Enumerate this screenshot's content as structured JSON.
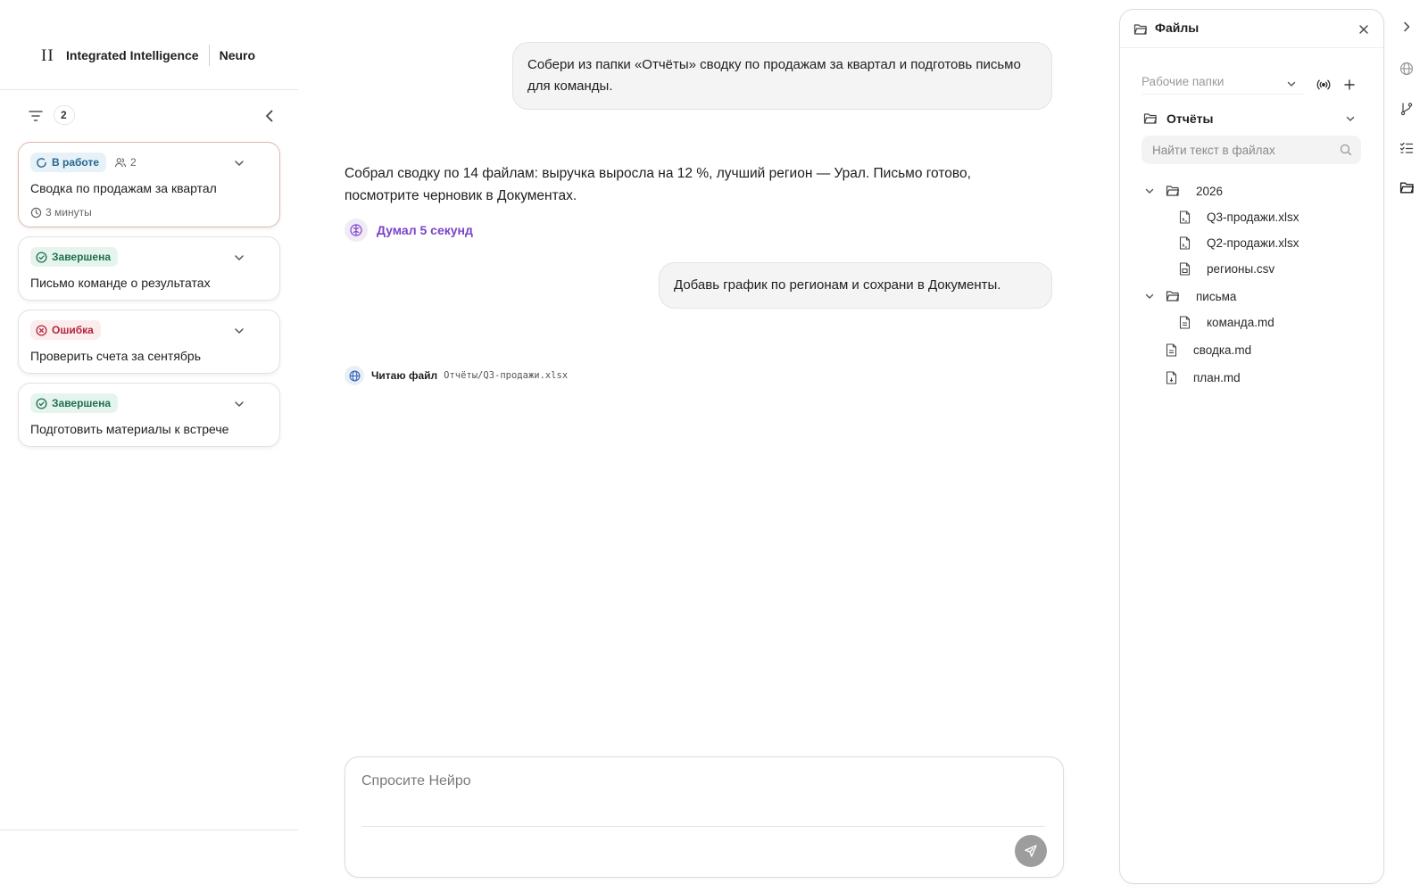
{
  "brand": {
    "logo": "II",
    "name": "Integrated Intelligence",
    "product": "Neuro"
  },
  "sidebar": {
    "filter_count": "2",
    "tasks": [
      {
        "status": "В работе",
        "status_kind": "progress",
        "members": "2",
        "title": "Сводка по продажам за квартал",
        "time": "3 минуты"
      },
      {
        "status": "Завершена",
        "status_kind": "done",
        "title": "Письмо команде о результатах"
      },
      {
        "status": "Ошибка",
        "status_kind": "error",
        "title": "Проверить счета за сентябрь"
      },
      {
        "status": "Завершена",
        "status_kind": "done",
        "title": "Подготовить материалы к встрече"
      }
    ]
  },
  "chat": {
    "user_message_1": "Собери из папки «Отчёты» сводку по продажам за квартал и подготовь письмо для команды.",
    "assistant_message": "Собрал сводку по 14 файлам: выручка выросла на 12 %, лучший регион — Урал. Письмо готово, посмотрите черновик в Документах.",
    "thinking_label": "Думал 5 секунд",
    "user_message_2": "Добавь график по регионам и сохрани в Документы.",
    "tool_label": "Читаю файл",
    "tool_path": "Отчёты/Q3-продажи.xlsx"
  },
  "composer": {
    "placeholder": "Спросите Нейро"
  },
  "files_panel": {
    "title": "Файлы",
    "workspace_placeholder": "Рабочие папки",
    "selected_folder": "Отчёты",
    "search_placeholder": "Найти текст в файлах",
    "tree": {
      "folder_2026": "2026",
      "file_q3": "Q3-продажи.xlsx",
      "file_q2": "Q2-продажи.xlsx",
      "file_regions": "регионы.csv",
      "folder_letters": "письма",
      "file_team": "команда.md",
      "file_summary": "сводка.md",
      "file_plan": "план.md"
    }
  },
  "colors": {
    "thinking_accent": "#7b44c8",
    "status_progress": "#25678f",
    "status_done": "#1f6f4f",
    "status_error": "#b3263d",
    "active_card_border": "#e0b7b0"
  },
  "icons": [
    "filter-icon",
    "chevron-left-icon",
    "spinner-icon",
    "users-icon",
    "clock-icon",
    "check-circle-icon",
    "x-circle-icon",
    "chevron-down-icon",
    "brain-icon",
    "globe-icon",
    "send-icon",
    "folder-icon",
    "close-icon",
    "broadcast-icon",
    "plus-icon",
    "search-icon",
    "spreadsheet-icon",
    "document-icon",
    "chevron-right-icon",
    "git-branch-icon",
    "checklist-icon"
  ]
}
